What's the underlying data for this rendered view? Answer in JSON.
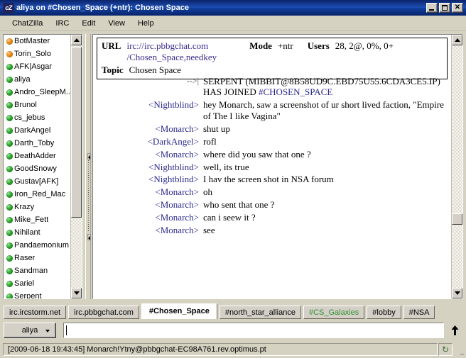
{
  "window": {
    "icon_label": "cZ",
    "icon_name": "chatzilla-icon",
    "title": "aliya on #Chosen_Space (+ntr): Chosen Space",
    "buttons": [
      {
        "name": "minimize-button",
        "label": "_"
      },
      {
        "name": "maximize-button",
        "label": "□"
      },
      {
        "name": "close-button",
        "label": "×"
      }
    ]
  },
  "menubar": {
    "items": [
      {
        "label": "ChatZilla",
        "name": "menu-chatzilla"
      },
      {
        "label": "IRC",
        "name": "menu-irc"
      },
      {
        "label": "Edit",
        "name": "menu-edit"
      },
      {
        "label": "View",
        "name": "menu-view"
      },
      {
        "label": "Help",
        "name": "menu-help"
      }
    ]
  },
  "nicklist": {
    "users": [
      {
        "nick": "BotMaster",
        "status": "op"
      },
      {
        "nick": "Torin_Solo",
        "status": "op"
      },
      {
        "nick": "AFK|Asgar",
        "status": "normal"
      },
      {
        "nick": "aliya",
        "status": "normal"
      },
      {
        "nick": "Andro_SleepM...",
        "status": "normal"
      },
      {
        "nick": "Brunol",
        "status": "normal"
      },
      {
        "nick": "cs_jebus",
        "status": "normal"
      },
      {
        "nick": "DarkAngel",
        "status": "normal"
      },
      {
        "nick": "Darth_Toby",
        "status": "normal"
      },
      {
        "nick": "DeathAdder",
        "status": "normal"
      },
      {
        "nick": "GoodSnowy",
        "status": "normal"
      },
      {
        "nick": "Gustav[AFK]",
        "status": "normal"
      },
      {
        "nick": "Iron_Red_Mac",
        "status": "normal"
      },
      {
        "nick": "Krazy",
        "status": "normal"
      },
      {
        "nick": "Mike_Fett",
        "status": "normal"
      },
      {
        "nick": "Nihilant",
        "status": "normal"
      },
      {
        "nick": "Pandaemonium",
        "status": "normal"
      },
      {
        "nick": "Raser",
        "status": "normal"
      },
      {
        "nick": "Sandman",
        "status": "normal"
      },
      {
        "nick": "Sariel",
        "status": "normal"
      },
      {
        "nick": "Serpent",
        "status": "normal"
      }
    ]
  },
  "channel_header": {
    "url_label": "URL",
    "url_line1": "irc://irc.pbbgchat.com",
    "url_line2": "/Chosen_Space,needkey",
    "mode_label": "Mode",
    "mode_value": "+ntr",
    "users_label": "Users",
    "users_value": "28, 2@, 0%, 0+",
    "topic_label": "Topic",
    "topic_value": "Chosen Space"
  },
  "messages": [
    {
      "type": "event",
      "who": "-->|",
      "text": "SERPENT (MIBBIT@8B58UD9C.EBD75U55.6CDA3CE5.IP) HAS JOINED ",
      "channel": "#CHOSEN_SPACE"
    },
    {
      "type": "say",
      "who": "<Nightblind>",
      "text": "hey Monarch, saw a screenshot of ur short lived faction, \"Empire of The I like Vagina\""
    },
    {
      "type": "say",
      "who": "<Monarch>",
      "text": "shut up"
    },
    {
      "type": "say",
      "who": "<DarkAngel>",
      "text": "rofl"
    },
    {
      "type": "say",
      "who": "<Monarch>",
      "text": "where did you saw that one ?"
    },
    {
      "type": "say",
      "who": "<Nightblind>",
      "text": "well, its true"
    },
    {
      "type": "say",
      "who": "<Nightblind>",
      "text": "I hav the screen shot in NSA forum"
    },
    {
      "type": "say",
      "who": "<Monarch>",
      "text": "oh"
    },
    {
      "type": "say",
      "who": "<Monarch>",
      "text": "who sent that one ?"
    },
    {
      "type": "say",
      "who": "<Monarch>",
      "text": "can i seew it ?"
    },
    {
      "type": "say",
      "who": "<Monarch>",
      "text": "see"
    }
  ],
  "tabs": [
    {
      "label": "irc.ircstorm.net",
      "name": "tab-irc-ircstorm-net",
      "state": "normal"
    },
    {
      "label": "irc.pbbgchat.com",
      "name": "tab-irc-pbbgchat-com",
      "state": "normal"
    },
    {
      "label": "#Chosen_Space",
      "name": "tab-chosen-space",
      "state": "active"
    },
    {
      "label": "#north_star_alliance",
      "name": "tab-north-star-alliance",
      "state": "normal"
    },
    {
      "label": "#CS_Galaxies",
      "name": "tab-cs-galaxies",
      "state": "activity"
    },
    {
      "label": "#lobby",
      "name": "tab-lobby",
      "state": "normal"
    },
    {
      "label": "#NSA",
      "name": "tab-nsa",
      "state": "normal"
    }
  ],
  "input": {
    "nick_button": "aliya",
    "value": "",
    "placeholder": "",
    "send_icon": "up-arrow-icon"
  },
  "statusbar": {
    "text": "[2009-06-18 19:43:45] Monarch!Ytny@pbbgchat-EC98A761.rev.optimus.pt",
    "icon": "↻"
  },
  "colors": {
    "titlebar": "#0a246a",
    "chrome": "#d6d2c2",
    "nick_text": "#2a2a8c",
    "url_text": "#3a2a8e",
    "tab_activity": "#2f8f2f",
    "op_bullet": "#f08a10",
    "user_bullet": "#2aa82a"
  }
}
